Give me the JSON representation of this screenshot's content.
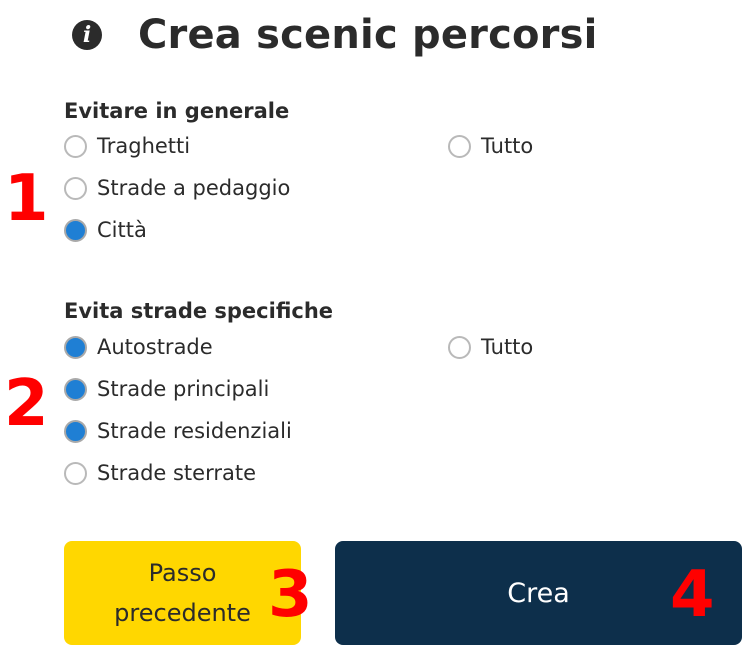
{
  "header": {
    "title": "Crea scenic percorsi",
    "icon": "info-icon"
  },
  "avoid_general": {
    "title": "Evitare in generale",
    "options": [
      {
        "label": "Traghetti",
        "checked": false
      },
      {
        "label": "Strade a pedaggio",
        "checked": false
      },
      {
        "label": "Città",
        "checked": true
      }
    ],
    "all_label": "Tutto",
    "all_checked": false
  },
  "avoid_specific": {
    "title": "Evita strade specifiche",
    "options": [
      {
        "label": "Autostrade",
        "checked": true
      },
      {
        "label": "Strade principali",
        "checked": true
      },
      {
        "label": "Strade residenziali",
        "checked": true
      },
      {
        "label": "Strade sterrate",
        "checked": false
      }
    ],
    "all_label": "Tutto",
    "all_checked": false
  },
  "buttons": {
    "back_label": "Passo precedente",
    "create_label": "Crea"
  },
  "annotations": [
    "1",
    "2",
    "3",
    "4"
  ],
  "colors": {
    "accent_radio": "#1f7fd4",
    "back_button": "#ffd700",
    "create_button": "#0d2f4b",
    "annotation": "#ff0000"
  }
}
